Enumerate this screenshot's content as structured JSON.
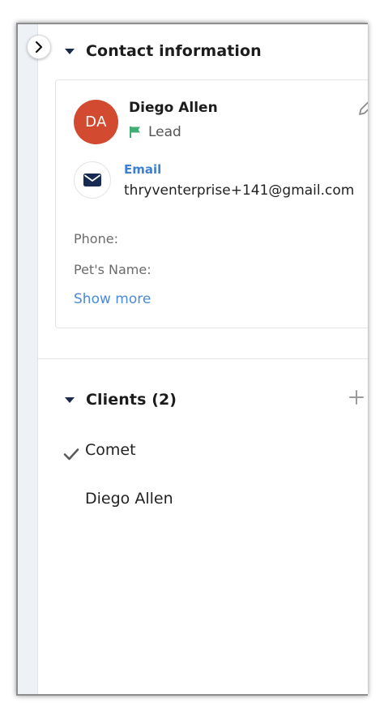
{
  "contact_section": {
    "title": "Contact information"
  },
  "contact": {
    "initials": "DA",
    "name": "Diego Allen",
    "status": "Lead",
    "email_label": "Email",
    "email": "thryventerprise+141@gmail.com",
    "fields": [
      {
        "label": "Phone:"
      },
      {
        "label": "Pet's Name:"
      }
    ],
    "show_more": "Show more"
  },
  "clients_section": {
    "title": "Clients (2)",
    "items": [
      {
        "name": "Comet",
        "selected": true
      },
      {
        "name": "Diego Allen",
        "selected": false
      }
    ]
  },
  "colors": {
    "avatar_bg": "#d24a2f",
    "link": "#3d7fd1",
    "lead_flag": "#3fae74",
    "heading": "#1b2a4a"
  },
  "icons": {
    "expand": "chevron-right-icon",
    "section_toggle": "caret-down-icon",
    "edit": "pencil-icon",
    "status": "flag-icon",
    "email": "envelope-icon",
    "add": "plus-icon",
    "selected": "checkmark-icon"
  }
}
